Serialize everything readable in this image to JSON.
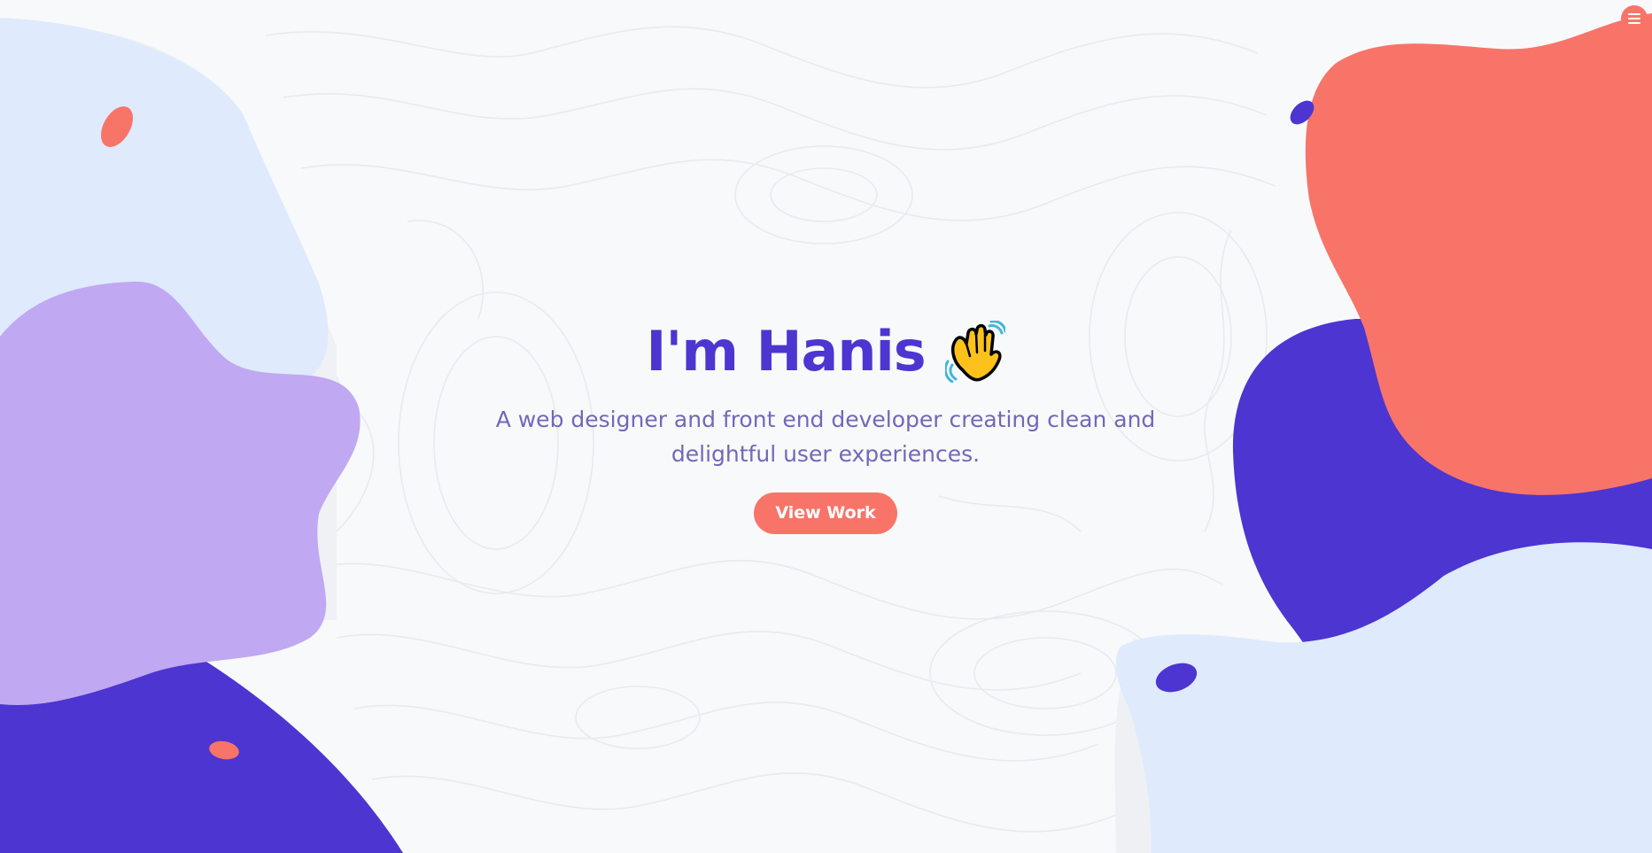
{
  "hero": {
    "title": "I'm Hanis",
    "emoji_icon": "waving-hand-icon",
    "subtitle": "A web designer and front end developer creating clean and delightful user experiences.",
    "cta_label": "View Work"
  },
  "nav": {
    "menu_icon": "hamburger-menu-icon"
  },
  "colors": {
    "background": "#f8f9fb",
    "brand_purple": "#4c35d1",
    "lavender": "#c0a8f2",
    "pale_blue": "#dfeafc",
    "coral": "#f87469",
    "subtitle": "#7367b9"
  }
}
